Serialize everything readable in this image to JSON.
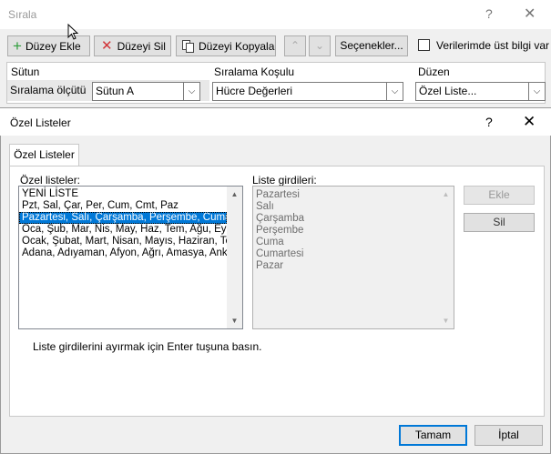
{
  "sort_dialog": {
    "title": "Sırala",
    "help_glyph": "?",
    "close_glyph": "✕",
    "toolbar": {
      "add_level_label": "Düzey Ekle",
      "delete_level_label": "Düzeyi Sil",
      "copy_level_label": "Düzeyi Kopyala",
      "move_up_glyph": "⌃",
      "move_down_glyph": "⌄",
      "options_label": "Seçenekler...",
      "header_checkbox_label": "Verilerimde üst bilgi var",
      "header_checkbox_checked": false
    },
    "grid": {
      "headers": {
        "column": "Sütun",
        "sort_on": "Sıralama Koşulu",
        "order": "Düzen"
      },
      "row": {
        "label": "Sıralama ölçütü",
        "column_value": "Sütun A",
        "sort_on_value": "Hücre Değerleri",
        "order_value": "Özel Liste..."
      }
    }
  },
  "custom_lists_dialog": {
    "title": "Özel Listeler",
    "help_glyph": "?",
    "close_glyph": "✕",
    "tab_label": "Özel Listeler",
    "lists_label": "Özel listeler:",
    "entries_label": "Liste girdileri:",
    "lists": [
      "YENİ LİSTE",
      "Pzt, Sal, Çar, Per, Cum, Cmt, Paz",
      "Pazartesi, Salı, Çarşamba, Perşembe, Cuma, C",
      "Oca, Şub, Mar, Nis, May, Haz, Tem, Ağu, Eyl, E",
      "Ocak, Şubat, Mart, Nisan, Mayıs, Haziran, Te",
      "Adana, Adıyaman, Afyon, Ağrı, Amasya, Anka"
    ],
    "selected_list_index": 2,
    "entries": [
      "Pazartesi",
      "Salı",
      "Çarşamba",
      "Perşembe",
      "Cuma",
      "Cumartesi",
      "Pazar"
    ],
    "add_label": "Ekle",
    "delete_label": "Sil",
    "hint": "Liste girdilerini ayırmak için Enter tuşuna basın.",
    "ok_label": "Tamam",
    "cancel_label": "İptal"
  },
  "colors": {
    "selection": "#0078d7",
    "dialog_bg": "#f0f0f0",
    "add_icon": "#2e9d3b",
    "delete_icon": "#d13438"
  }
}
